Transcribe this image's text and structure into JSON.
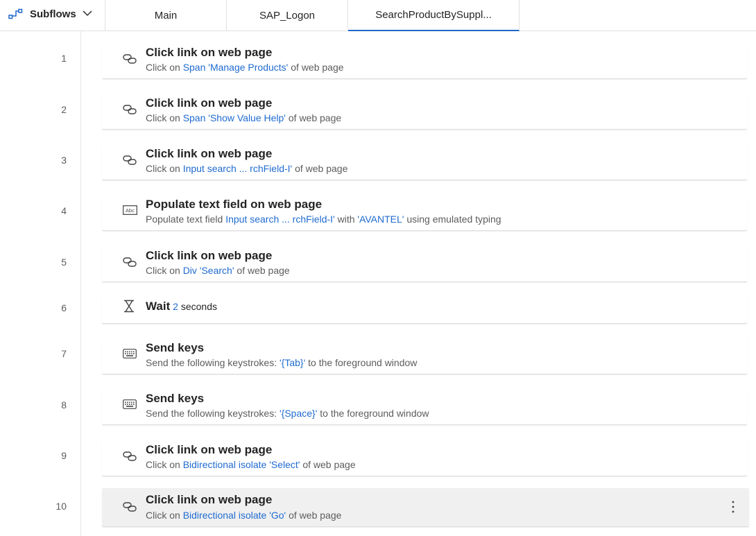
{
  "tabbar": {
    "subflows_label": "Subflows",
    "tabs": [
      {
        "label": "Main"
      },
      {
        "label": "SAP_Logon"
      },
      {
        "label": "SearchProductBySuppl..."
      }
    ]
  },
  "actions": [
    {
      "number": "1",
      "icon": "link-icon",
      "title": "Click link on web page",
      "desc": {
        "pre": "Click on ",
        "link": "Span 'Manage Products'",
        "post": " of web page"
      }
    },
    {
      "number": "2",
      "icon": "link-icon",
      "title": "Click link on web page",
      "desc": {
        "pre": "Click on ",
        "link": "Span 'Show Value Help'",
        "post": " of web page"
      }
    },
    {
      "number": "3",
      "icon": "link-icon",
      "title": "Click link on web page",
      "desc": {
        "pre": "Click on ",
        "link": "Input search  ... rchField-I'",
        "post": " of web page"
      }
    },
    {
      "number": "4",
      "icon": "text-field-icon",
      "title": "Populate text field on web page",
      "desc": {
        "pre": "Populate text field ",
        "link": "Input search  ... rchField-I'",
        "mid": " with ",
        "link2": "'AVANTEL'",
        "post": " using emulated typing"
      }
    },
    {
      "number": "5",
      "icon": "link-icon",
      "title": "Click link on web page",
      "desc": {
        "pre": "Click on ",
        "link": "Div 'Search'",
        "post": " of web page"
      }
    },
    {
      "number": "6",
      "icon": "hourglass-icon",
      "title": "Wait",
      "inline": {
        "value": "2",
        "unit": " seconds"
      }
    },
    {
      "number": "7",
      "icon": "keyboard-icon",
      "title": "Send keys",
      "desc": {
        "pre": "Send the following keystrokes: ",
        "link": "'{Tab}'",
        "post": " to the foreground window"
      }
    },
    {
      "number": "8",
      "icon": "keyboard-icon",
      "title": "Send keys",
      "desc": {
        "pre": "Send the following keystrokes: ",
        "link": "'{Space}'",
        "post": " to the foreground window"
      }
    },
    {
      "number": "9",
      "icon": "link-icon",
      "title": "Click link on web page",
      "desc": {
        "pre": "Click on ",
        "link": "Bidirectional isolate 'Select'",
        "post": " of web page"
      }
    },
    {
      "number": "10",
      "icon": "link-icon",
      "title": "Click link on web page",
      "desc": {
        "pre": "Click on ",
        "link": "Bidirectional isolate 'Go'",
        "post": " of web page"
      }
    }
  ],
  "colors": {
    "accent": "#1f67c8",
    "link": "#1f6bd0",
    "selected_row": "#f0f0f0"
  },
  "icons": {
    "subflows": "subflow-icon",
    "dropdown": "chevron-down-icon",
    "more": "more-options-icon"
  }
}
